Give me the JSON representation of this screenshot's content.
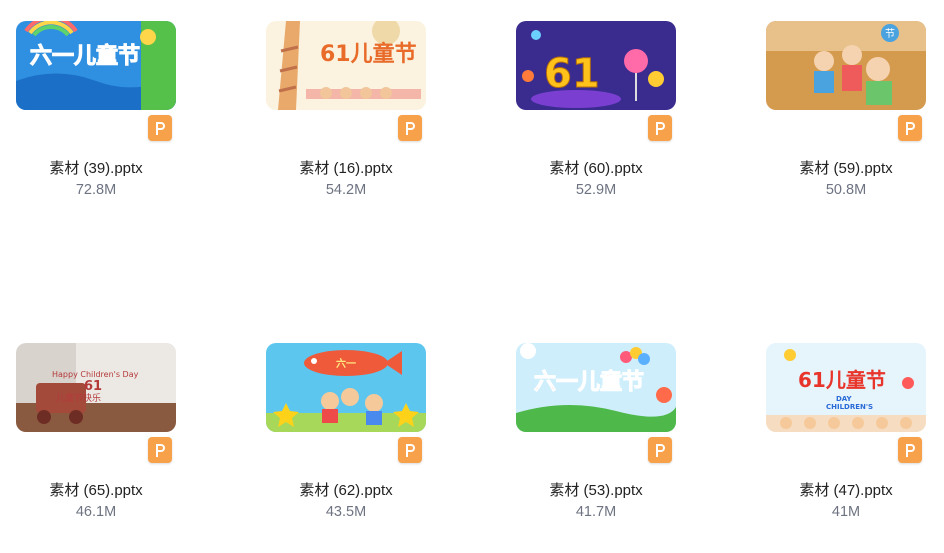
{
  "files": [
    {
      "name": "素材 (39).pptx",
      "size": "72.8M",
      "icon": "pptx-file-icon"
    },
    {
      "name": "素材 (16).pptx",
      "size": "54.2M",
      "icon": "pptx-file-icon"
    },
    {
      "name": "素材 (60).pptx",
      "size": "52.9M",
      "icon": "pptx-file-icon"
    },
    {
      "name": "素材 (59).pptx",
      "size": "50.8M",
      "icon": "pptx-file-icon"
    },
    {
      "name": "素材 (65).pptx",
      "size": "46.1M",
      "icon": "pptx-file-icon"
    },
    {
      "name": "素材 (62).pptx",
      "size": "43.5M",
      "icon": "pptx-file-icon"
    },
    {
      "name": "素材 (53).pptx",
      "size": "41.7M",
      "icon": "pptx-file-icon"
    },
    {
      "name": "素材 (47).pptx",
      "size": "41M",
      "icon": "pptx-file-icon"
    }
  ],
  "thumb_text": {
    "t0_title": "六一儿童节",
    "t1_title": "61儿童节",
    "t2_title": "61",
    "t3_badge": "节",
    "t4_line1": "Happy Children's Day",
    "t4_line2": "61",
    "t4_line3": "儿童节快乐",
    "t5_fish": "六一",
    "t6_title": "六一儿童节",
    "t7_title": "61儿童节",
    "t7_sub1": "DAY",
    "t7_sub2": "CHILDREN'S"
  },
  "colors": {
    "badge": "#f7a24b",
    "filename": "#222222",
    "filesize": "#6e7382"
  }
}
